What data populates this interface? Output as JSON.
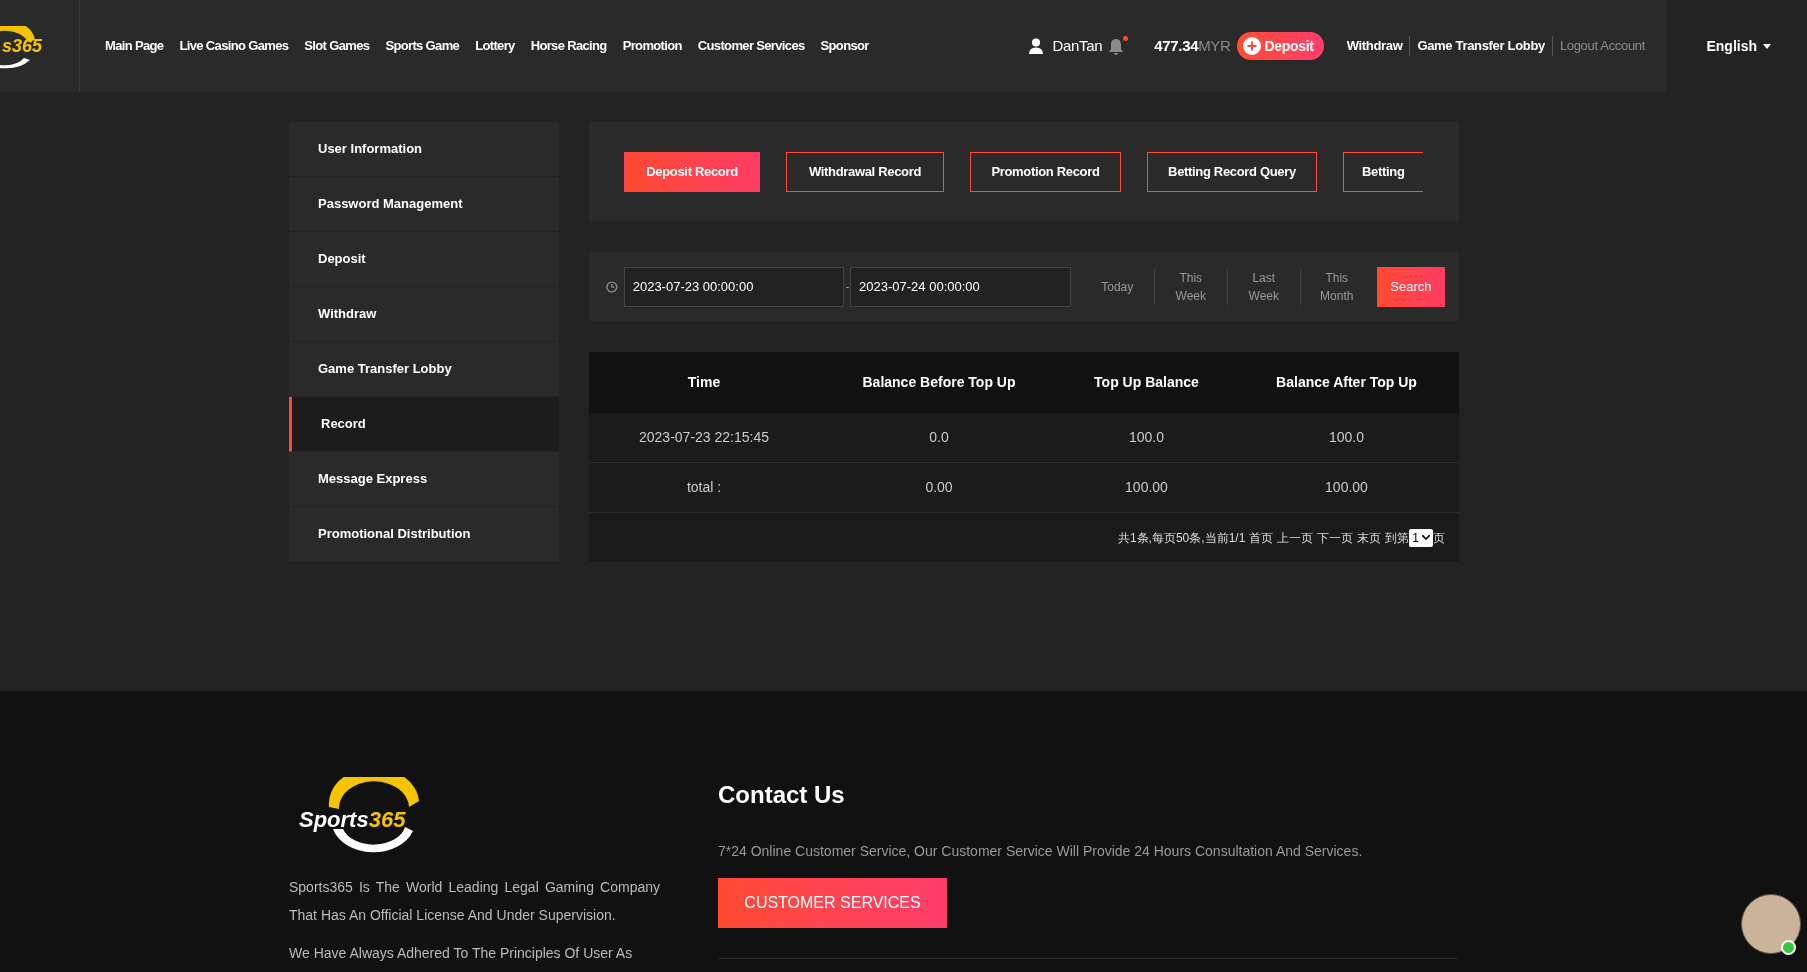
{
  "header": {
    "logo_text": "s365",
    "nav": [
      "Main Page",
      "Live Casino Games",
      "Slot Games",
      "Sports Game",
      "Lottery",
      "Horse Racing",
      "Promotion",
      "Customer Services",
      "Sponsor"
    ],
    "username": "DanTan",
    "notification_dot": true,
    "balance": "477.34",
    "currency": "MYR",
    "deposit_button": "Deposit",
    "links": [
      {
        "label": "Withdraw",
        "kind": "main"
      },
      {
        "label": "Game Transfer Lobby",
        "kind": "main"
      },
      {
        "label": "Logout Account",
        "kind": "muted"
      }
    ],
    "language": "English"
  },
  "sidebar": {
    "items": [
      {
        "label": "User Information",
        "selected": false
      },
      {
        "label": "Password Management",
        "selected": false
      },
      {
        "label": "Deposit",
        "selected": false
      },
      {
        "label": "Withdraw",
        "selected": false
      },
      {
        "label": "Game Transfer Lobby",
        "selected": false
      },
      {
        "label": "Record",
        "selected": true
      },
      {
        "label": "Message Express",
        "selected": false
      },
      {
        "label": "Promotional Distribution",
        "selected": false
      }
    ]
  },
  "tabs": [
    {
      "label": "Deposit Record",
      "selected": true
    },
    {
      "label": "Withdrawal Record",
      "selected": false
    },
    {
      "label": "Promotion Record",
      "selected": false
    },
    {
      "label": "Betting Record Query",
      "selected": false
    },
    {
      "label": "Betting",
      "selected": false
    }
  ],
  "filter": {
    "start": "2023-07-23 00:00:00",
    "separator": "-",
    "end": "2023-07-24 00:00:00",
    "periods": [
      [
        "Today"
      ],
      [
        "This",
        "Week"
      ],
      [
        "Last",
        "Week"
      ],
      [
        "This",
        "Month"
      ]
    ],
    "search_button": "Search"
  },
  "table": {
    "columns": [
      "Time",
      "Balance Before Top Up",
      "Top Up Balance",
      "Balance After Top Up"
    ],
    "rows": [
      [
        "2023-07-23 22:15:45",
        "0.0",
        "100.0",
        "100.0"
      ],
      [
        "total :",
        "0.00",
        "100.00",
        "100.00"
      ]
    ],
    "pagination": {
      "summary": "共1条,每页50条,当前1/1",
      "links": [
        "首页",
        "上一页",
        "下一页",
        "末页"
      ],
      "goto_label": "到第",
      "page": "1",
      "suffix": "页"
    }
  },
  "footer": {
    "logo_word": "Sports",
    "logo_number": "365",
    "paragraphs": [
      "Sports365 Is The World Leading Legal Gaming Company That Has An Official License And Under Supervision.",
      "We Have Always Adhered To The Principles Of User As"
    ],
    "contact_title": "Contact Us",
    "contact_text": "7*24 Online Customer Service, Our Customer Service Will Provide 24 Hours Consultation And Services.",
    "contact_button": "CUSTOMER SERVICES"
  },
  "chat_avatar": {
    "online": true
  }
}
